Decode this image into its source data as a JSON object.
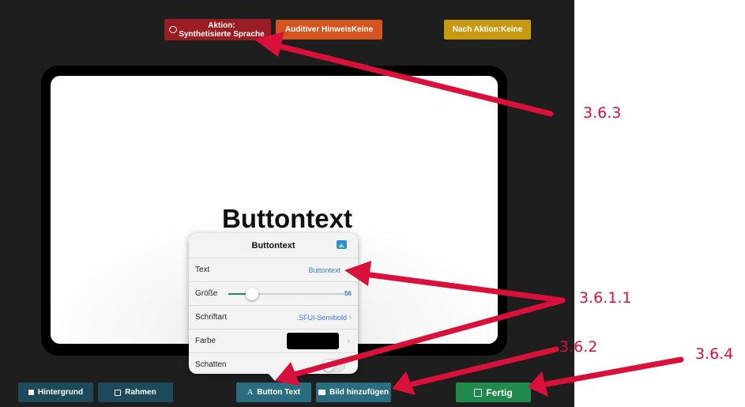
{
  "toolbar_top": {
    "aktion_line1": "Aktion:",
    "aktion_line2": "Synthetisierte Sprache",
    "auditiv": "Auditiver HinweisKeine",
    "nach_aktion": "Nach Aktion:Keine"
  },
  "canvas": {
    "button_text": "Buttontext"
  },
  "popover": {
    "title": "Buttontext",
    "text_label": "Text",
    "text_value": "Buttontext",
    "size_label": "Größe",
    "size_value": "56",
    "font_label": "Schriftart",
    "font_value": ".SFUI-Semibold",
    "color_label": "Farbe",
    "shadow_label": "Schatten",
    "size_fraction": 0.2
  },
  "toolbar_bottom": {
    "hintergrund": "Hintergrund",
    "rahmen": "Rahmen",
    "button_text_prefix": "A",
    "button_text": "Button Text",
    "bild": "Bild hinzufügen",
    "fertig": "Fertig"
  },
  "annotations": {
    "a1": "3.6.3",
    "a2": "3.6.1.1",
    "a3": "3.6.2",
    "a4": "3.6.4"
  },
  "colors": {
    "annotation": "#d8103a",
    "aktion": "#9b1c22",
    "auditiv": "#d3541e",
    "nach_aktion": "#c79a12",
    "fertig": "#1f8a4c",
    "accent": "#3a7bd5"
  }
}
